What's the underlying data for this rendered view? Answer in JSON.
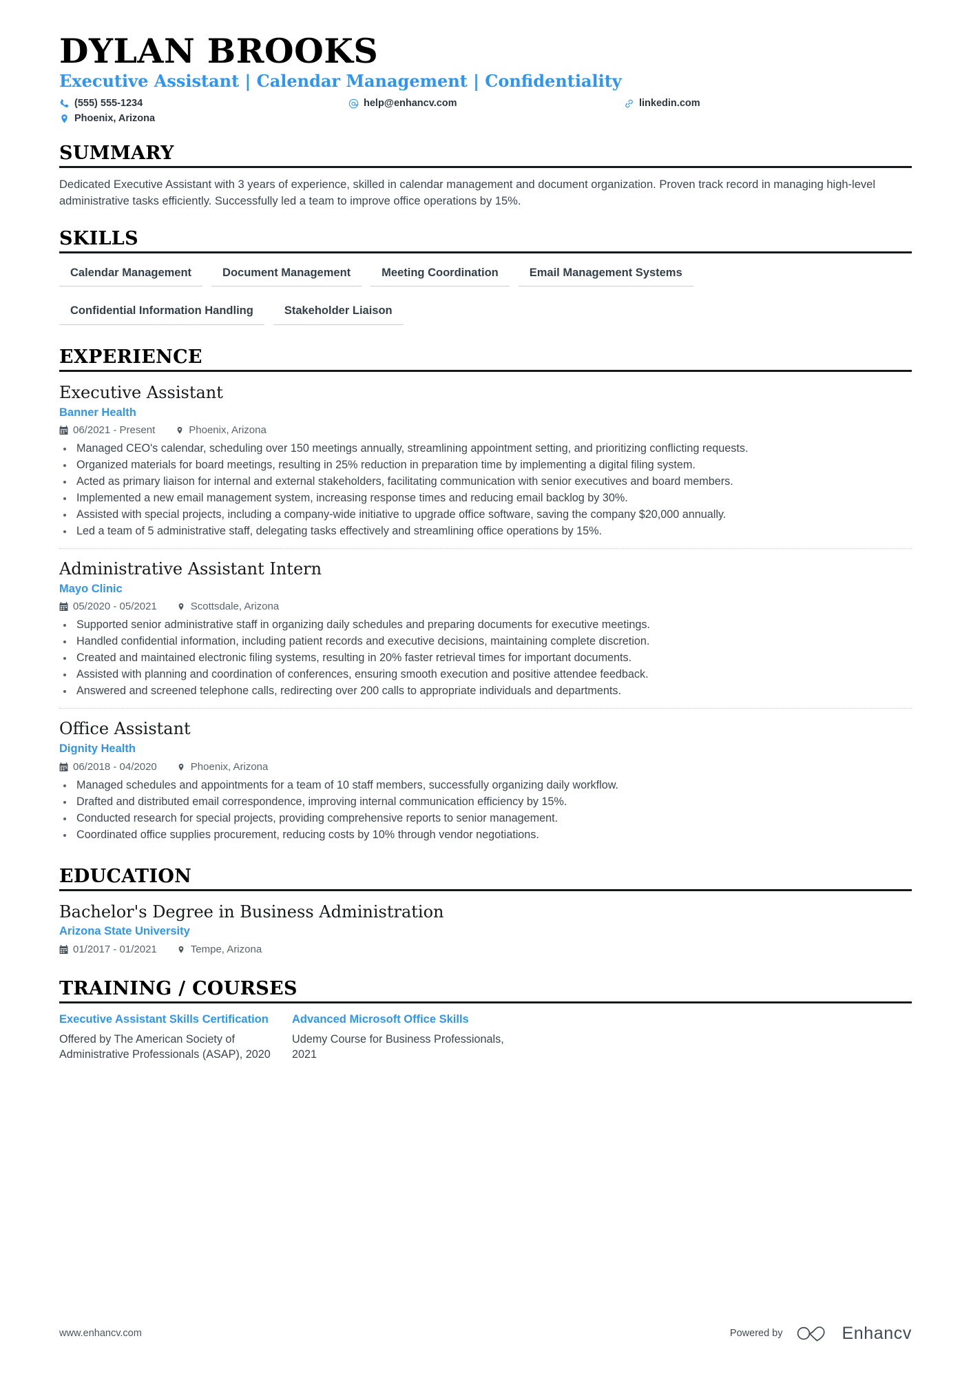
{
  "theme": {
    "accent": "#2f95f3",
    "text": "#3b4650",
    "heading": "#000000",
    "rule": "#16181a",
    "tag_border": "#c9cfd4"
  },
  "header": {
    "name": "DYLAN BROOKS",
    "headline": "Executive Assistant | Calendar Management | Confidentiality",
    "contacts": [
      {
        "icon": "phone-icon",
        "text": "(555) 555-1234"
      },
      {
        "icon": "email-icon",
        "text": "help@enhancv.com"
      },
      {
        "icon": "link-icon",
        "text": "linkedin.com"
      },
      {
        "icon": "location-icon",
        "text": "Phoenix, Arizona"
      }
    ]
  },
  "summary": {
    "heading": "SUMMARY",
    "text": "Dedicated Executive Assistant with 3 years of experience, skilled in calendar management and document organization. Proven track record in managing high-level administrative tasks efficiently. Successfully led a team to improve office operations by 15%."
  },
  "skills": {
    "heading": "SKILLS",
    "items": [
      "Calendar Management",
      "Document Management",
      "Meeting Coordination",
      "Email Management Systems",
      "Confidential Information Handling",
      "Stakeholder Liaison"
    ]
  },
  "experience": {
    "heading": "EXPERIENCE",
    "entries": [
      {
        "title": "Executive Assistant",
        "organization": "Banner Health",
        "dates": "06/2021 - Present",
        "location": "Phoenix, Arizona",
        "bullets": [
          "Managed CEO's calendar, scheduling over 150 meetings annually, streamlining appointment setting, and prioritizing conflicting requests.",
          "Organized materials for board meetings, resulting in 25% reduction in preparation time by implementing a digital filing system.",
          "Acted as primary liaison for internal and external stakeholders, facilitating communication with senior executives and board members.",
          "Implemented a new email management system, increasing response times and reducing email backlog by 30%.",
          "Assisted with special projects, including a company-wide initiative to upgrade office software, saving the company $20,000 annually.",
          "Led a team of 5 administrative staff, delegating tasks effectively and streamlining office operations by 15%."
        ]
      },
      {
        "title": "Administrative Assistant Intern",
        "organization": "Mayo Clinic",
        "dates": "05/2020 - 05/2021",
        "location": "Scottsdale, Arizona",
        "bullets": [
          "Supported senior administrative staff in organizing daily schedules and preparing documents for executive meetings.",
          "Handled confidential information, including patient records and executive decisions, maintaining complete discretion.",
          "Created and maintained electronic filing systems, resulting in 20% faster retrieval times for important documents.",
          "Assisted with planning and coordination of conferences, ensuring smooth execution and positive attendee feedback.",
          "Answered and screened telephone calls, redirecting over 200 calls to appropriate individuals and departments."
        ]
      },
      {
        "title": "Office Assistant",
        "organization": "Dignity Health",
        "dates": "06/2018 - 04/2020",
        "location": "Phoenix, Arizona",
        "bullets": [
          "Managed schedules and appointments for a team of 10 staff members, successfully organizing daily workflow.",
          "Drafted and distributed email correspondence, improving internal communication efficiency by 15%.",
          "Conducted research for special projects, providing comprehensive reports to senior management.",
          "Coordinated office supplies procurement, reducing costs by 10% through vendor negotiations."
        ]
      }
    ]
  },
  "education": {
    "heading": "EDUCATION",
    "entries": [
      {
        "title": "Bachelor's Degree in Business Administration",
        "organization": "Arizona State University",
        "dates": "01/2017 - 01/2021",
        "location": "Tempe, Arizona"
      }
    ]
  },
  "training": {
    "heading": "TRAINING / COURSES",
    "courses": [
      {
        "title": "Executive Assistant Skills Certification",
        "description": "Offered by The American Society of Administrative Professionals (ASAP), 2020"
      },
      {
        "title": "Advanced Microsoft Office Skills",
        "description": "Udemy Course for Business Professionals, 2021"
      }
    ]
  },
  "footer": {
    "url": "www.enhancv.com",
    "powered_by": "Powered by",
    "brand": "Enhancv"
  }
}
